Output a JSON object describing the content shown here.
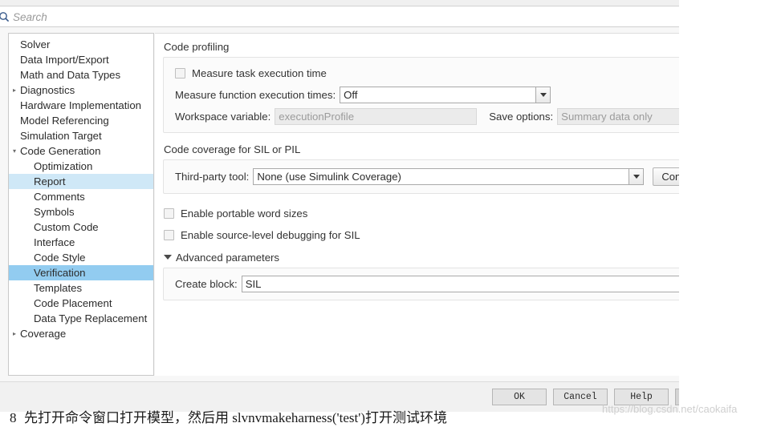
{
  "search": {
    "placeholder": "Search",
    "value": "",
    "icon": "search-icon"
  },
  "tree": {
    "items": [
      {
        "label": "Solver",
        "level": 0,
        "twisty": "",
        "state": ""
      },
      {
        "label": "Data Import/Export",
        "level": 0,
        "twisty": "",
        "state": ""
      },
      {
        "label": "Math and Data Types",
        "level": 0,
        "twisty": "",
        "state": ""
      },
      {
        "label": "Diagnostics",
        "level": 0,
        "twisty": "▸",
        "state": ""
      },
      {
        "label": "Hardware Implementation",
        "level": 0,
        "twisty": "",
        "state": ""
      },
      {
        "label": "Model Referencing",
        "level": 0,
        "twisty": "",
        "state": ""
      },
      {
        "label": "Simulation Target",
        "level": 0,
        "twisty": "",
        "state": ""
      },
      {
        "label": "Code Generation",
        "level": 0,
        "twisty": "▾",
        "state": ""
      },
      {
        "label": "Optimization",
        "level": 1,
        "twisty": "",
        "state": ""
      },
      {
        "label": "Report",
        "level": 1,
        "twisty": "",
        "state": "hover"
      },
      {
        "label": "Comments",
        "level": 1,
        "twisty": "",
        "state": ""
      },
      {
        "label": "Symbols",
        "level": 1,
        "twisty": "",
        "state": ""
      },
      {
        "label": "Custom Code",
        "level": 1,
        "twisty": "",
        "state": ""
      },
      {
        "label": "Interface",
        "level": 1,
        "twisty": "",
        "state": ""
      },
      {
        "label": "Code Style",
        "level": 1,
        "twisty": "",
        "state": ""
      },
      {
        "label": "Verification",
        "level": 1,
        "twisty": "",
        "state": "selected"
      },
      {
        "label": "Templates",
        "level": 1,
        "twisty": "",
        "state": ""
      },
      {
        "label": "Code Placement",
        "level": 1,
        "twisty": "",
        "state": ""
      },
      {
        "label": "Data Type Replacement",
        "level": 1,
        "twisty": "",
        "state": ""
      },
      {
        "label": "Coverage",
        "level": 0,
        "twisty": "▸",
        "state": ""
      }
    ]
  },
  "content": {
    "code_profiling": {
      "title": "Code profiling",
      "measure_task_label": "Measure task execution time",
      "measure_task_checked": false,
      "measure_function_label": "Measure function execution times:",
      "measure_function_value": "Off",
      "workspace_variable_label": "Workspace variable:",
      "workspace_variable_value": "executionProfile",
      "save_options_label": "Save options:",
      "save_options_value": "Summary data only"
    },
    "code_coverage": {
      "title": "Code coverage for SIL or PIL",
      "third_party_label": "Third-party tool:",
      "third_party_value": "None (use Simulink Coverage)",
      "configure_button": "Configure..."
    },
    "checkboxes": [
      {
        "label": "Enable portable word sizes",
        "checked": false
      },
      {
        "label": "Enable source-level debugging for SIL",
        "checked": false
      }
    ],
    "advanced": {
      "title": "Advanced parameters",
      "expanded": true,
      "create_block_label": "Create block:",
      "create_block_value": "SIL"
    }
  },
  "footer": {
    "ok": "OK",
    "cancel": "Cancel",
    "help": "Help",
    "apply": ""
  },
  "page_note": {
    "number": "8",
    "text": "先打开命令窗口打开模型，然后用 slvnvmakeharness('test')打开测试环境"
  },
  "watermark": "https://blog.csdn.net/caokaifa",
  "colors": {
    "selection": "#92ccf0",
    "hover": "#cfe8f7",
    "search_icon": "#3a5b8c"
  }
}
